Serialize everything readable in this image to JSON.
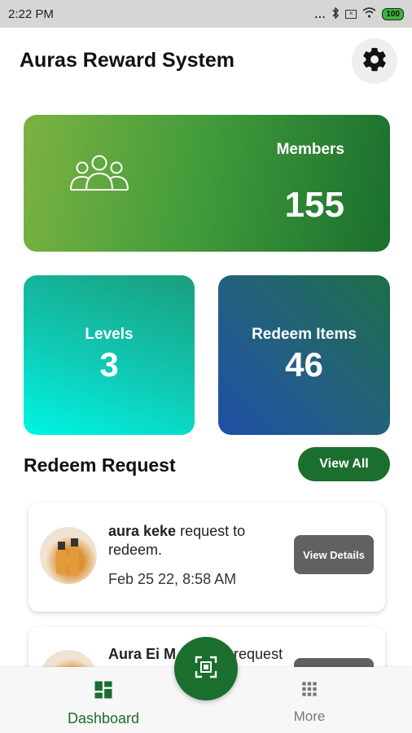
{
  "status_bar": {
    "time": "2:22 PM",
    "battery": "100",
    "dots": "..."
  },
  "header": {
    "title": "Auras Reward System",
    "settings_icon": "gear-icon"
  },
  "colors": {
    "primary": "#1b6e2e",
    "details_button": "#616161"
  },
  "stats": {
    "members": {
      "label": "Members",
      "value": "155",
      "icon": "people-group-icon"
    },
    "levels": {
      "label": "Levels",
      "value": "3"
    },
    "redeem_items": {
      "label": "Redeem Items",
      "value": "46"
    }
  },
  "redeem_section": {
    "title": "Redeem Request",
    "view_all_label": "View All",
    "requests": [
      {
        "name": "aura keke",
        "message": " request to redeem.",
        "time": "Feb 25 22, 8:58 AM",
        "button": "View Details"
      },
      {
        "name": "Aura  Ei M",
        "message": "request"
      }
    ]
  },
  "bottom_nav": {
    "items": [
      {
        "label": "Dashboard",
        "icon": "dashboard-icon",
        "active": true
      },
      {
        "label": "More",
        "icon": "grid-icon",
        "active": false
      }
    ],
    "fab_icon": "qr-scan-icon"
  }
}
